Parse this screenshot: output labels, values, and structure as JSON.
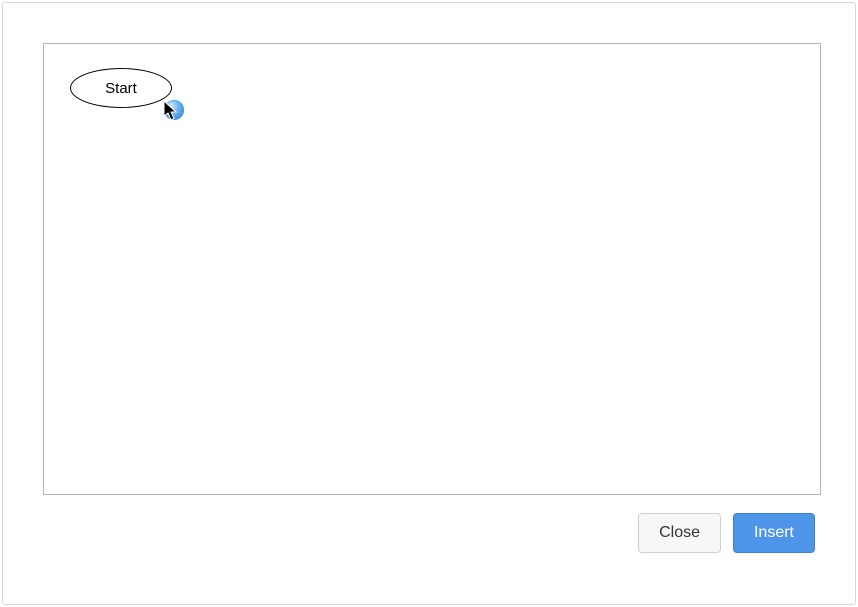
{
  "canvas": {
    "start_node_label": "Start"
  },
  "buttons": {
    "close_label": "Close",
    "insert_label": "Insert"
  }
}
